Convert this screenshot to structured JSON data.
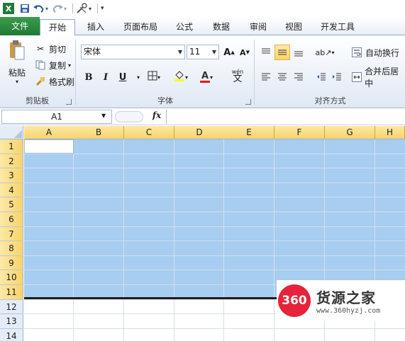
{
  "colors": {
    "file_tab": "#1f7a35",
    "selection": "#a7cdf0",
    "header_selected": "#f8d36b",
    "watermark_red": "#e6233a"
  },
  "qat": {
    "undo_icon": "undo-icon",
    "redo_icon": "redo-icon",
    "save_icon": "save-icon"
  },
  "tabs": [
    {
      "label": "文件"
    },
    {
      "label": "开始"
    },
    {
      "label": "插入"
    },
    {
      "label": "页面布局"
    },
    {
      "label": "公式"
    },
    {
      "label": "数据"
    },
    {
      "label": "审阅"
    },
    {
      "label": "视图"
    },
    {
      "label": "开发工具"
    }
  ],
  "clipboard": {
    "paste": "粘贴",
    "cut": "剪切",
    "copy": "复制",
    "format_painter": "格式刷",
    "group_label": "剪贴板"
  },
  "font": {
    "name": "宋体",
    "size": "11",
    "bold": "B",
    "italic": "I",
    "underline": "U",
    "group_label": "字体",
    "grow": "A",
    "shrink": "A",
    "color_letter": "A",
    "wen": "wén"
  },
  "alignment": {
    "wrap": "自动换行",
    "merge": "合并后居中",
    "group_label": "对齐方式"
  },
  "formula_bar": {
    "name_box": "A1",
    "fx": "fx"
  },
  "grid": {
    "columns": [
      "A",
      "B",
      "C",
      "D",
      "E",
      "F",
      "G",
      "H"
    ],
    "rows": [
      "1",
      "2",
      "3",
      "4",
      "5",
      "6",
      "7",
      "8",
      "9",
      "10",
      "11",
      "12",
      "13",
      "14"
    ],
    "selected_rows": 11
  },
  "watermark": {
    "logo": "360",
    "title": "货源之家",
    "url": "www.360hyzj.com"
  }
}
